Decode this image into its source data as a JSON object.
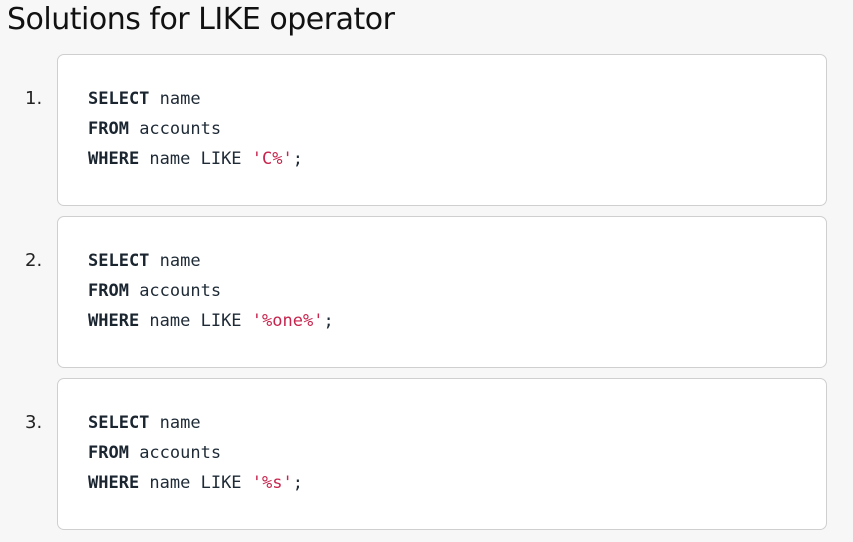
{
  "page": {
    "title": "Solutions for LIKE operator"
  },
  "solutions": [
    {
      "number": "1.",
      "lines": [
        {
          "keyword": "SELECT",
          "text": " name",
          "string": "",
          "tail": ""
        },
        {
          "keyword": "FROM",
          "text": " accounts",
          "string": "",
          "tail": ""
        },
        {
          "keyword": "WHERE",
          "text": " name LIKE ",
          "string": "'C%'",
          "tail": ";"
        }
      ]
    },
    {
      "number": "2.",
      "lines": [
        {
          "keyword": "SELECT",
          "text": " name",
          "string": "",
          "tail": ""
        },
        {
          "keyword": "FROM",
          "text": " accounts",
          "string": "",
          "tail": ""
        },
        {
          "keyword": "WHERE",
          "text": " name LIKE ",
          "string": "'%one%'",
          "tail": ";"
        }
      ]
    },
    {
      "number": "3.",
      "lines": [
        {
          "keyword": "SELECT",
          "text": " name",
          "string": "",
          "tail": ""
        },
        {
          "keyword": "FROM",
          "text": " accounts",
          "string": "",
          "tail": ""
        },
        {
          "keyword": "WHERE",
          "text": " name LIKE ",
          "string": "'%s'",
          "tail": ";"
        }
      ]
    }
  ],
  "colors": {
    "background": "#f7f7f7",
    "code_background": "#ffffff",
    "code_border": "#cfcfcf",
    "keyword": "#1a2530",
    "string_literal": "#c7254e"
  }
}
